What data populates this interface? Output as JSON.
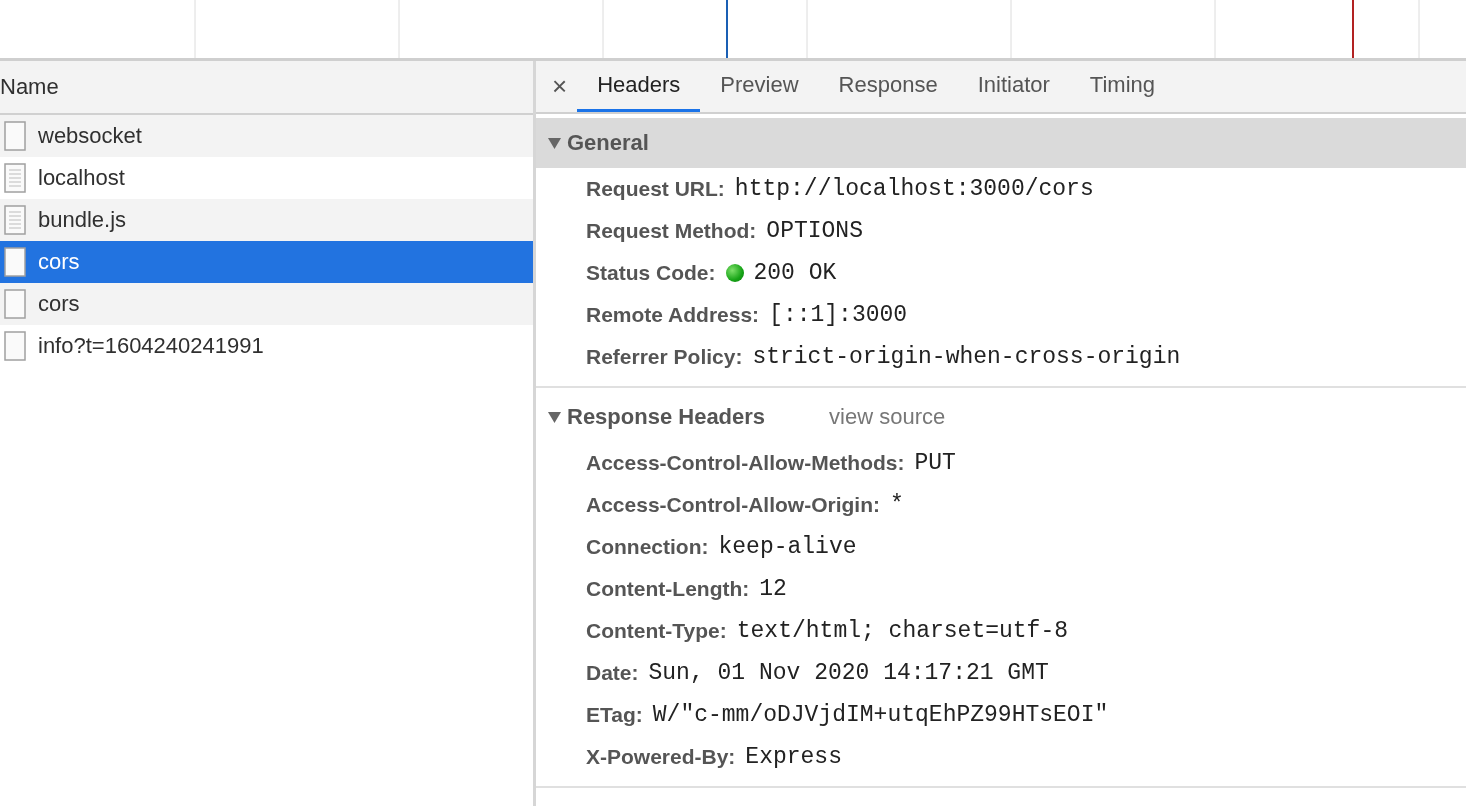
{
  "requests": {
    "column_header": "Name",
    "rows": [
      {
        "name": "websocket",
        "kind": "blank",
        "selected": false
      },
      {
        "name": "localhost",
        "kind": "document",
        "selected": false
      },
      {
        "name": "bundle.js",
        "kind": "document",
        "selected": false
      },
      {
        "name": "cors",
        "kind": "blank",
        "selected": true
      },
      {
        "name": "cors",
        "kind": "blank",
        "selected": false
      },
      {
        "name": "info?t=1604240241991",
        "kind": "blank",
        "selected": false
      }
    ]
  },
  "details": {
    "close": "×",
    "tabs": [
      {
        "label": "Headers",
        "selected": true
      },
      {
        "label": "Preview",
        "selected": false
      },
      {
        "label": "Response",
        "selected": false
      },
      {
        "label": "Initiator",
        "selected": false
      },
      {
        "label": "Timing",
        "selected": false
      }
    ],
    "sections": [
      {
        "title": "General",
        "expanded": true,
        "highlighted": true,
        "entries": [
          {
            "name": "Request URL:",
            "value": "http://localhost:3000/cors",
            "kind": "plain"
          },
          {
            "name": "Request Method:",
            "value": "OPTIONS",
            "kind": "plain"
          },
          {
            "name": "Status Code:",
            "value": "200 OK",
            "kind": "status"
          },
          {
            "name": "Remote Address:",
            "value": "[::1]:3000",
            "kind": "plain"
          },
          {
            "name": "Referrer Policy:",
            "value": "strict-origin-when-cross-origin",
            "kind": "plain"
          }
        ]
      },
      {
        "title": "Response Headers",
        "link": "view source",
        "expanded": true,
        "highlighted": false,
        "entries": [
          {
            "name": "Access-Control-Allow-Methods:",
            "value": "PUT",
            "kind": "plain"
          },
          {
            "name": "Access-Control-Allow-Origin:",
            "value": "*",
            "kind": "plain"
          },
          {
            "name": "Connection:",
            "value": "keep-alive",
            "kind": "plain"
          },
          {
            "name": "Content-Length:",
            "value": "12",
            "kind": "plain"
          },
          {
            "name": "Content-Type:",
            "value": "text/html; charset=utf-8",
            "kind": "plain"
          },
          {
            "name": "Date:",
            "value": "Sun, 01 Nov 2020 14:17:21 GMT",
            "kind": "plain"
          },
          {
            "name": "ETag:",
            "value": "W/\"c-mm/oDJVjdIM+utqEhPZ99HTsEOI\"",
            "kind": "plain"
          },
          {
            "name": "X-Powered-By:",
            "value": "Express",
            "kind": "plain"
          }
        ]
      }
    ]
  }
}
